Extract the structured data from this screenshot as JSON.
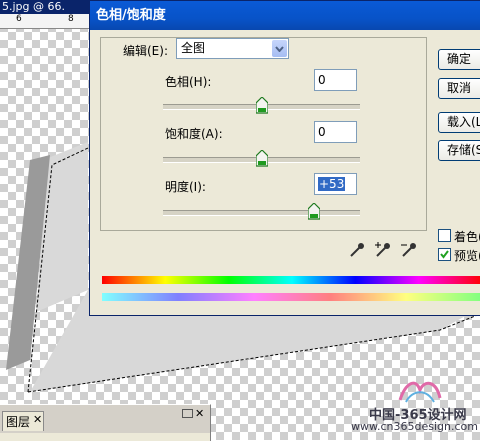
{
  "document": {
    "title_fragment": "5.jpg @ 66.",
    "ruler_ticks": [
      "6",
      "8"
    ]
  },
  "dialog": {
    "title": "色相/饱和度",
    "edit_label": "编辑(E):",
    "edit_value": "全图",
    "hue": {
      "label": "色相(H):",
      "value": "0",
      "slider_fraction": 0.5
    },
    "saturation": {
      "label": "饱和度(A):",
      "value": "0",
      "slider_fraction": 0.5
    },
    "lightness": {
      "label": "明度(I):",
      "value": "+53",
      "slider_fraction": 0.765
    },
    "buttons": {
      "ok": "确定",
      "cancel": "取消",
      "load": "载入(L)...",
      "save": "存储(S)..."
    },
    "colorize": {
      "label": "着色(O)",
      "checked": false
    },
    "preview": {
      "label": "预览(P)",
      "checked": true
    },
    "eyedroppers": [
      "eyedropper-icon",
      "eyedropper-plus-icon",
      "eyedropper-minus-icon"
    ]
  },
  "layers_panel": {
    "tab_label": "图层",
    "close_glyph": "✕"
  },
  "watermark": {
    "line1": "中国-365设计网",
    "line2": "www.cn365design.com"
  },
  "colors": {
    "title_bar": "#0a53c8",
    "dialog_bg": "#ece9d8",
    "selection": "#316ac5",
    "thumb": "#1f9a1f"
  }
}
